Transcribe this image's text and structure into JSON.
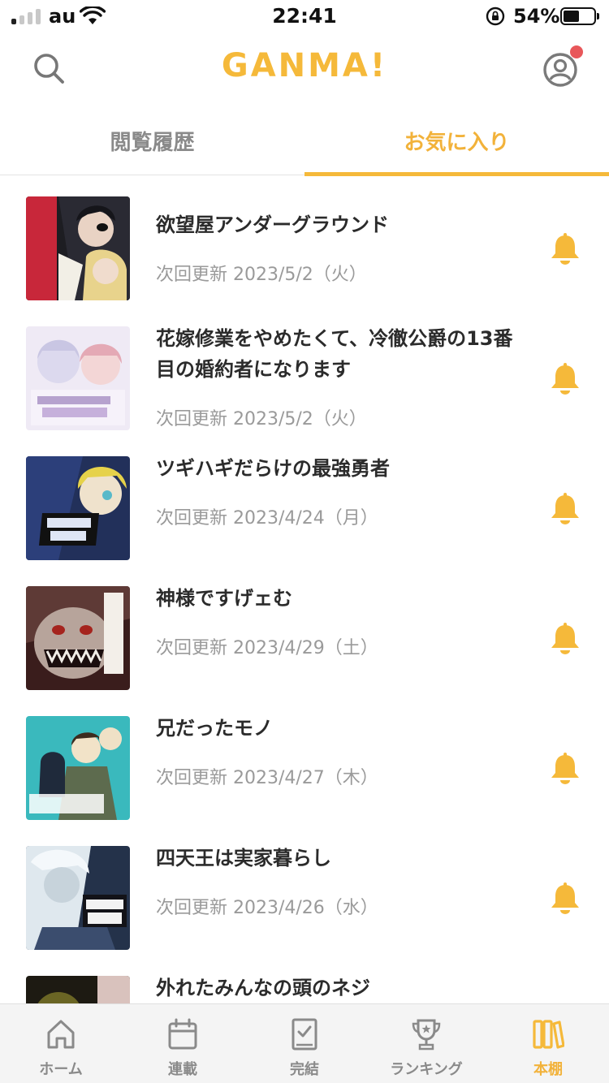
{
  "status_bar": {
    "carrier": "au",
    "time": "22:41",
    "battery_percent": "54%",
    "battery_level": 0.54
  },
  "header": {
    "logo": "GANMA!",
    "search_icon": "search-icon",
    "profile_icon": "profile-icon",
    "has_notification": true
  },
  "tabs": [
    {
      "label": "閲覧履歴",
      "active": false
    },
    {
      "label": "お気に入り",
      "active": true
    }
  ],
  "favorites": [
    {
      "title": "欲望屋アンダーグラウンド",
      "next_update": "次回更新 2023/5/2（火）",
      "bell": "bell-icon"
    },
    {
      "title": "花嫁修業をやめたくて、冷徹公爵の13番目の婚約者になります",
      "next_update": "次回更新 2023/5/2（火）",
      "bell": "bell-icon"
    },
    {
      "title": "ツギハギだらけの最強勇者",
      "next_update": "次回更新 2023/4/24（月）",
      "bell": "bell-icon"
    },
    {
      "title": "神様ですげェむ",
      "next_update": "次回更新 2023/4/29（土）",
      "bell": "bell-icon"
    },
    {
      "title": "兄だったモノ",
      "next_update": "次回更新 2023/4/27（木）",
      "bell": "bell-icon"
    },
    {
      "title": "四天王は実家暮らし",
      "next_update": "次回更新 2023/4/26（水）",
      "bell": "bell-icon"
    },
    {
      "title": "外れたみんなの頭のネジ",
      "next_update": "",
      "bell": ""
    }
  ],
  "bottom_nav": [
    {
      "label": "ホーム",
      "icon": "home-icon",
      "active": false
    },
    {
      "label": "連載",
      "icon": "calendar-icon",
      "active": false
    },
    {
      "label": "完結",
      "icon": "completed-book-icon",
      "active": false
    },
    {
      "label": "ランキング",
      "icon": "trophy-icon",
      "active": false
    },
    {
      "label": "本棚",
      "icon": "bookshelf-icon",
      "active": true
    }
  ],
  "colors": {
    "accent": "#f5b93a",
    "text_dark": "#2b2b2b",
    "text_gray": "#9a9a9a",
    "notification": "#e8575a"
  }
}
